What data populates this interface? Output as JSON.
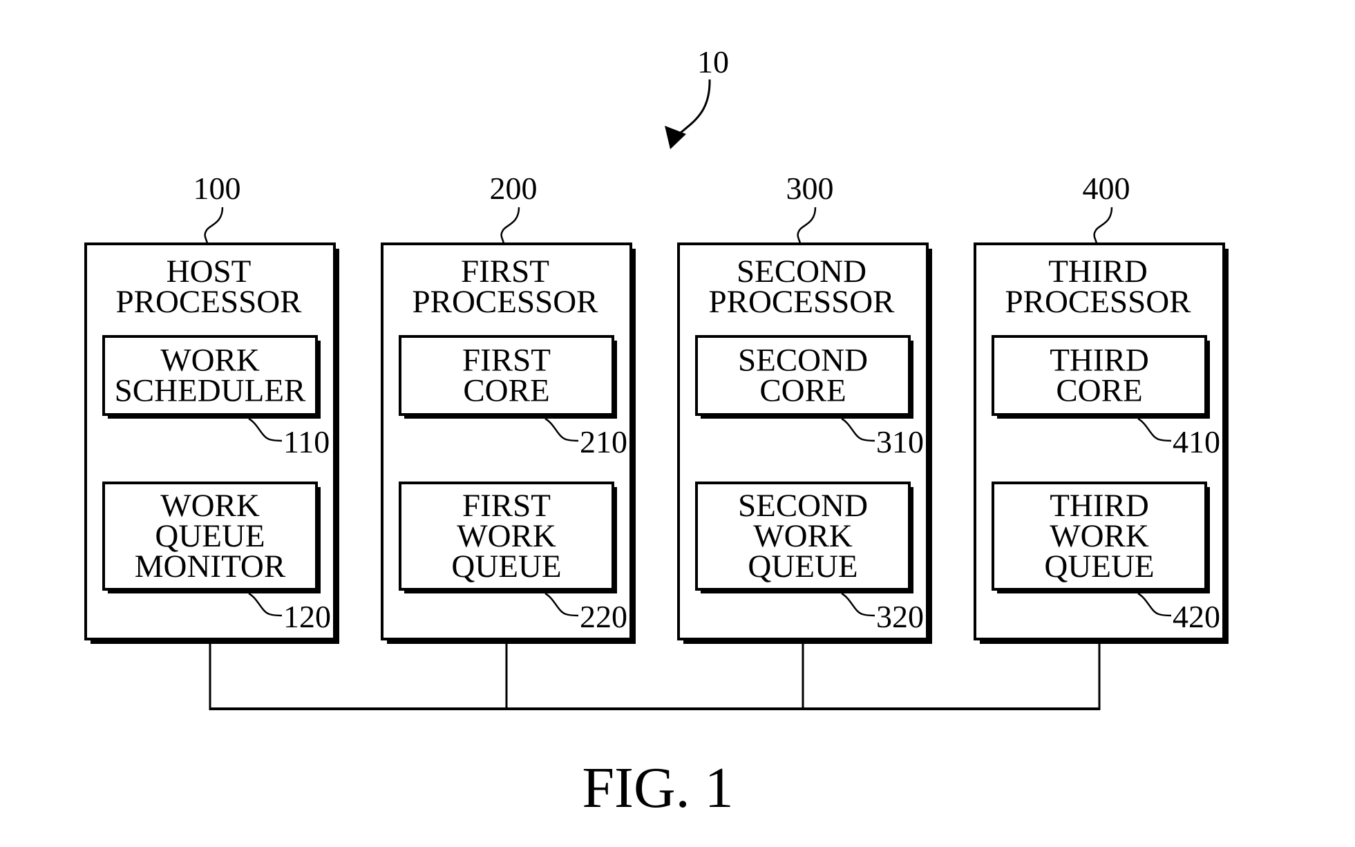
{
  "figure": {
    "system_ref": "10",
    "caption": "FIG. 1",
    "processors": [
      {
        "ref": "100",
        "title_lines": [
          "HOST",
          "PROCESSOR"
        ],
        "components": [
          {
            "ref": "110",
            "lines": [
              "WORK",
              "SCHEDULER"
            ]
          },
          {
            "ref": "120",
            "lines": [
              "WORK",
              "QUEUE",
              "MONITOR"
            ]
          }
        ]
      },
      {
        "ref": "200",
        "title_lines": [
          "FIRST",
          "PROCESSOR"
        ],
        "components": [
          {
            "ref": "210",
            "lines": [
              "FIRST",
              "CORE"
            ]
          },
          {
            "ref": "220",
            "lines": [
              "FIRST",
              "WORK",
              "QUEUE"
            ]
          }
        ]
      },
      {
        "ref": "300",
        "title_lines": [
          "SECOND",
          "PROCESSOR"
        ],
        "components": [
          {
            "ref": "310",
            "lines": [
              "SECOND",
              "CORE"
            ]
          },
          {
            "ref": "320",
            "lines": [
              "SECOND",
              "WORK",
              "QUEUE"
            ]
          }
        ]
      },
      {
        "ref": "400",
        "title_lines": [
          "THIRD",
          "PROCESSOR"
        ],
        "components": [
          {
            "ref": "410",
            "lines": [
              "THIRD",
              "CORE"
            ]
          },
          {
            "ref": "420",
            "lines": [
              "THIRD",
              "WORK",
              "QUEUE"
            ]
          }
        ]
      }
    ],
    "colors": {
      "ink": "#000000",
      "paper": "#ffffff"
    }
  }
}
